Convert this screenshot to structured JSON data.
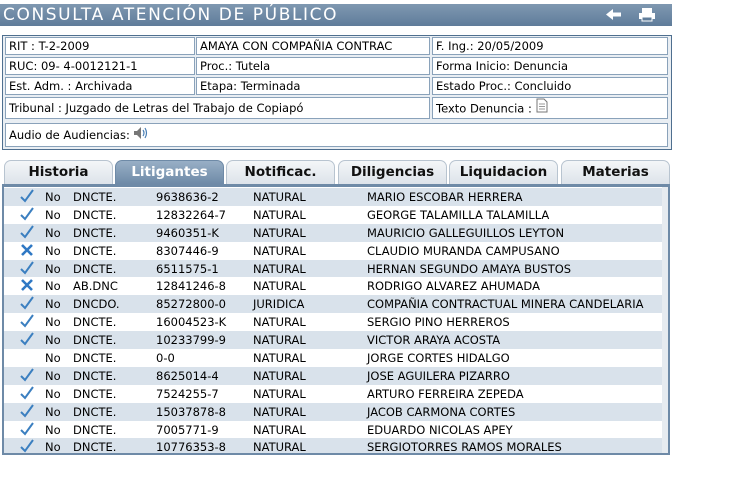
{
  "header": {
    "title": "CONSULTA ATENCIÓN DE PÚBLICO",
    "back_icon": "back-arrow-icon",
    "print_icon": "printer-icon"
  },
  "info": {
    "rit": "RIT : T-2-2009",
    "caratulado": "AMAYA CON COMPAÑIA CONTRAC",
    "fecha_ing": "F. Ing.: 20/05/2009",
    "ruc": "RUC: 09- 4-0012121-1",
    "proc": "Proc.: Tutela",
    "forma_inicio": "Forma Inicio: Denuncia",
    "est_adm": "Est. Adm. : Archivada",
    "etapa": "Etapa: Terminada",
    "estado_proc": "Estado Proc.: Concluido",
    "tribunal": "Tribunal : Juzgado de Letras del Trabajo de Copiapó",
    "texto_denuncia": "Texto Denuncia :",
    "audio": "Audio de Audiencias:",
    "doc_icon": "document-icon",
    "audio_icon": "speaker-icon"
  },
  "tabs": [
    {
      "label": "Historia",
      "active": false
    },
    {
      "label": "Litigantes",
      "active": true
    },
    {
      "label": "Notificac.",
      "active": false
    },
    {
      "label": "Diligencias",
      "active": false
    },
    {
      "label": "Liquidacion",
      "active": false
    },
    {
      "label": "Materias",
      "active": false
    }
  ],
  "colors": {
    "check": "#3b7fc0",
    "cross": "#2f78c4",
    "header": "#6e8aa7"
  },
  "litigantes": [
    {
      "icon": "check",
      "estado": "No",
      "tipo": "DNCTE.",
      "rut": "9638636-2",
      "persona": "NATURAL",
      "nombre": "MARIO ESCOBAR HERRERA"
    },
    {
      "icon": "check",
      "estado": "No",
      "tipo": "DNCTE.",
      "rut": "12832264-7",
      "persona": "NATURAL",
      "nombre": "GEORGE TALAMILLA TALAMILLA"
    },
    {
      "icon": "check",
      "estado": "No",
      "tipo": "DNCTE.",
      "rut": "9460351-K",
      "persona": "NATURAL",
      "nombre": "MAURICIO GALLEGUILLOS LEYTON"
    },
    {
      "icon": "cross",
      "estado": "No",
      "tipo": "DNCTE.",
      "rut": "8307446-9",
      "persona": "NATURAL",
      "nombre": "CLAUDIO MURANDA CAMPUSANO"
    },
    {
      "icon": "check",
      "estado": "No",
      "tipo": "DNCTE.",
      "rut": "6511575-1",
      "persona": "NATURAL",
      "nombre": "HERNAN SEGUNDO AMAYA BUSTOS"
    },
    {
      "icon": "cross",
      "estado": "No",
      "tipo": "AB.DNC",
      "rut": "12841246-8",
      "persona": "NATURAL",
      "nombre": "RODRIGO ALVAREZ AHUMADA"
    },
    {
      "icon": "check",
      "estado": "No",
      "tipo": "DNCDO.",
      "rut": "85272800-0",
      "persona": "JURIDICA",
      "nombre": "COMPAÑIA CONTRACTUAL MINERA CANDELARIA"
    },
    {
      "icon": "check",
      "estado": "No",
      "tipo": "DNCTE.",
      "rut": "16004523-K",
      "persona": "NATURAL",
      "nombre": "SERGIO PINO HERREROS"
    },
    {
      "icon": "check",
      "estado": "No",
      "tipo": "DNCTE.",
      "rut": "10233799-9",
      "persona": "NATURAL",
      "nombre": "VICTOR ARAYA ACOSTA"
    },
    {
      "icon": "",
      "estado": "No",
      "tipo": "DNCTE.",
      "rut": "0-0",
      "persona": "NATURAL",
      "nombre": "JORGE CORTES HIDALGO"
    },
    {
      "icon": "check",
      "estado": "No",
      "tipo": "DNCTE.",
      "rut": "8625014-4",
      "persona": "NATURAL",
      "nombre": "JOSE AGUILERA PIZARRO"
    },
    {
      "icon": "check",
      "estado": "No",
      "tipo": "DNCTE.",
      "rut": "7524255-7",
      "persona": "NATURAL",
      "nombre": "ARTURO FERREIRA ZEPEDA"
    },
    {
      "icon": "check",
      "estado": "No",
      "tipo": "DNCTE.",
      "rut": "15037878-8",
      "persona": "NATURAL",
      "nombre": "JACOB CARMONA CORTES"
    },
    {
      "icon": "check",
      "estado": "No",
      "tipo": "DNCTE.",
      "rut": "7005771-9",
      "persona": "NATURAL",
      "nombre": "EDUARDO NICOLAS APEY"
    },
    {
      "icon": "check",
      "estado": "No",
      "tipo": "DNCTE.",
      "rut": "10776353-8",
      "persona": "NATURAL",
      "nombre": "SERGIOTORRES RAMOS MORALES"
    }
  ]
}
